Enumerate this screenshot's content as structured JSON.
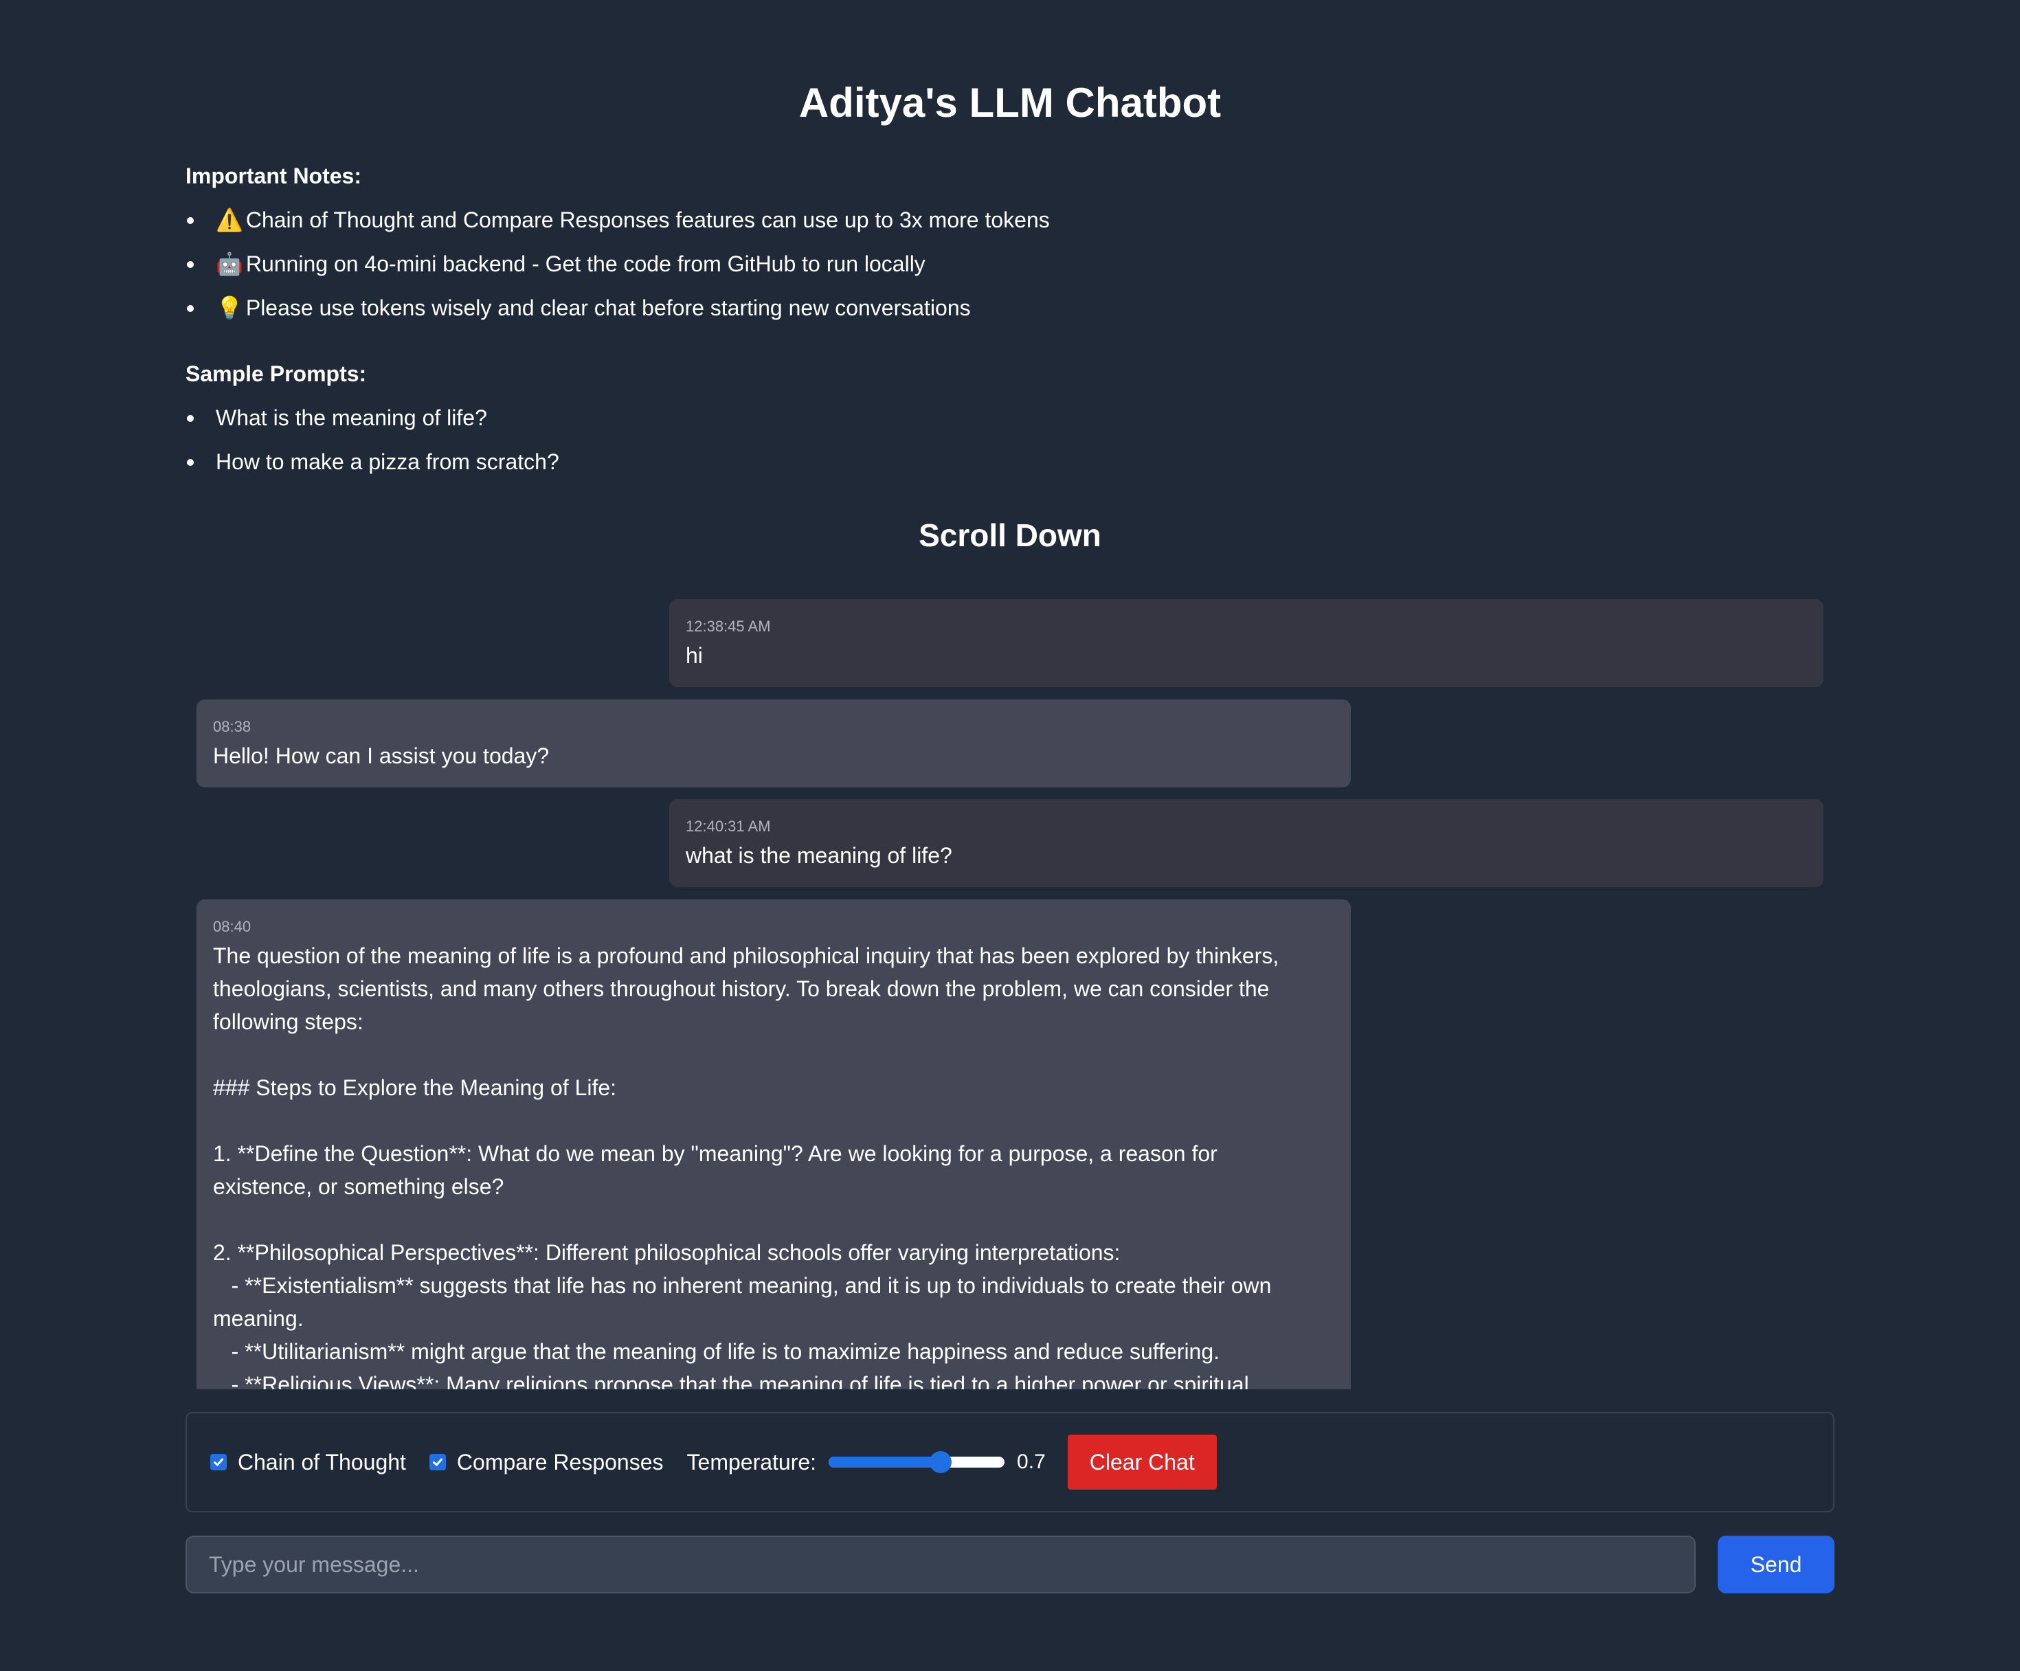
{
  "header": {
    "title": "Aditya's LLM Chatbot"
  },
  "notes": {
    "heading": "Important Notes:",
    "items": [
      {
        "icon": "warning-icon",
        "emoji": "⚠️",
        "text": "Chain of Thought and Compare Responses features can use up to 3x more tokens"
      },
      {
        "icon": "robot-icon",
        "emoji": "🤖",
        "text": "Running on 4o-mini backend - Get the code from GitHub to run locally"
      },
      {
        "icon": "lightbulb-icon",
        "emoji": "💡",
        "text": "Please use tokens wisely and clear chat before starting new conversations"
      }
    ]
  },
  "samples": {
    "heading": "Sample Prompts:",
    "items": [
      "What is the meaning of life?",
      "How to make a pizza from scratch?"
    ]
  },
  "scroll_heading": "Scroll Down",
  "messages": [
    {
      "role": "user",
      "time": "12:38:45 AM",
      "text": "hi"
    },
    {
      "role": "assistant",
      "time": "08:38",
      "text": "Hello! How can I assist you today?"
    },
    {
      "role": "user",
      "time": "12:40:31 AM",
      "text": "what is the meaning of life?"
    },
    {
      "role": "assistant",
      "time": "08:40",
      "text": "The question of the meaning of life is a profound and philosophical inquiry that has been explored by thinkers,\ntheologians, scientists, and many others throughout history. To break down the problem, we can consider the\nfollowing steps:\n\n### Steps to Explore the Meaning of Life:\n\n1. **Define the Question**: What do we mean by \"meaning\"? Are we looking for a purpose, a reason for\nexistence, or something else?\n\n2. **Philosophical Perspectives**: Different philosophical schools offer varying interpretations:\n   - **Existentialism** suggests that life has no inherent meaning, and it is up to individuals to create their own\nmeaning.\n   - **Utilitarianism** might argue that the meaning of life is to maximize happiness and reduce suffering.\n   - **Religious Views**: Many religions propose that the meaning of life is tied to a higher power or spiritual"
    }
  ],
  "controls": {
    "chain_of_thought": {
      "label": "Chain of Thought",
      "checked": true
    },
    "compare_responses": {
      "label": "Compare Responses",
      "checked": true
    },
    "temperature": {
      "label": "Temperature:",
      "value": 0.7,
      "value_text": "0.7",
      "min": 0,
      "max": 1.1
    },
    "clear_label": "Clear Chat"
  },
  "composer": {
    "placeholder": "Type your message...",
    "value": "",
    "send_label": "Send"
  },
  "colors": {
    "background": "#1f2937",
    "user_bubble": "#353642",
    "assistant_bubble": "#434756",
    "accent": "#2563eb",
    "danger": "#dc2626"
  }
}
